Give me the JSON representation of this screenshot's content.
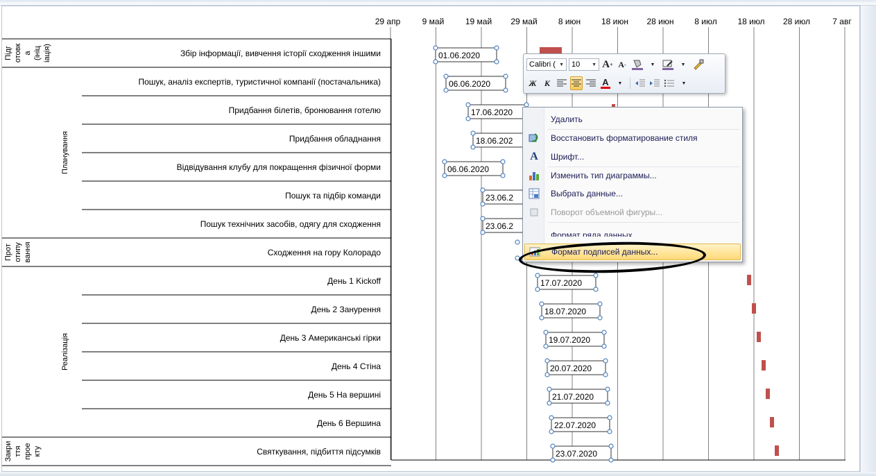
{
  "timeline": {
    "ticks": [
      "29 апр",
      "9 май",
      "19 май",
      "29 май",
      "8 июн",
      "18 июн",
      "28 июн",
      "8 июл",
      "18 июл",
      "28 июл",
      "7 авг"
    ]
  },
  "phases": [
    {
      "label": "Підг отовк а (ініц іація)"
    },
    {
      "label": "Планування"
    },
    {
      "label": "Прот отипу вання"
    },
    {
      "label": "Реалізація"
    },
    {
      "label": "Закри ття прое кту"
    }
  ],
  "tasks": [
    {
      "name": "Збір інформації,  вивчення історії сходження іншими",
      "date_label": "01.06.2020"
    },
    {
      "name": "Пошук, аналіз експертів, туристичної компанії (постачальника)",
      "date_label": "06.06.2020"
    },
    {
      "name": "Придбання білетів, бронювання готелю",
      "date_label": "17.06.2020"
    },
    {
      "name": "Придбання обладнання",
      "date_label": "18.06.202"
    },
    {
      "name": "Відвідування  клубу для покращення фізичної форми",
      "date_label": "06.06.2020"
    },
    {
      "name": "Пошук та підбір команди",
      "date_label": "23.06.2"
    },
    {
      "name": "Пошук технічних засобів, одягу для сходження",
      "date_label": "23.06.2"
    },
    {
      "name": "Сходження на гору Колорадо",
      "date_label": ""
    },
    {
      "name": "День 1 Kickoff",
      "date_label": "17.07.2020"
    },
    {
      "name": "День 2 Занурення",
      "date_label": "18.07.2020"
    },
    {
      "name": "День 3 Американські гірки",
      "date_label": "19.07.2020"
    },
    {
      "name": "День 4 Стіна",
      "date_label": "20.07.2020"
    },
    {
      "name": "День 5 На вершині",
      "date_label": "21.07.2020"
    },
    {
      "name": "День 6 Вершина",
      "date_label": "22.07.2020"
    },
    {
      "name": "Святкування,  підбиття підсумків",
      "date_label": "23.07.2020"
    }
  ],
  "mini_toolbar": {
    "font": "Calibri (",
    "size": "10",
    "bold": "Ж",
    "italic": "К"
  },
  "context_menu": {
    "items": [
      {
        "label": "Удалить",
        "icon": "none",
        "disabled": false
      },
      {
        "label": "Восстановить форматирование стиля",
        "icon": "reset-style-icon",
        "disabled": false
      },
      {
        "label": "Шрифт...",
        "icon": "font-icon",
        "disabled": false
      },
      {
        "label": "Изменить тип диаграммы...",
        "icon": "chart-type-icon",
        "disabled": false
      },
      {
        "label": "Выбрать данные...",
        "icon": "select-data-icon",
        "disabled": false
      },
      {
        "label": "Поворот объемной фигуры...",
        "icon": "3d-rotation-icon",
        "disabled": true
      },
      {
        "label": "Формат ряда данных...",
        "icon": "none",
        "disabled": false
      },
      {
        "label": "Формат подписей данных...",
        "icon": "format-labels-icon",
        "disabled": false,
        "highlighted": true
      }
    ]
  },
  "colors": {
    "bar": "#c0504d",
    "grid": "#808080",
    "label_border": "#4f81bd",
    "highlight": "#ffd977"
  }
}
